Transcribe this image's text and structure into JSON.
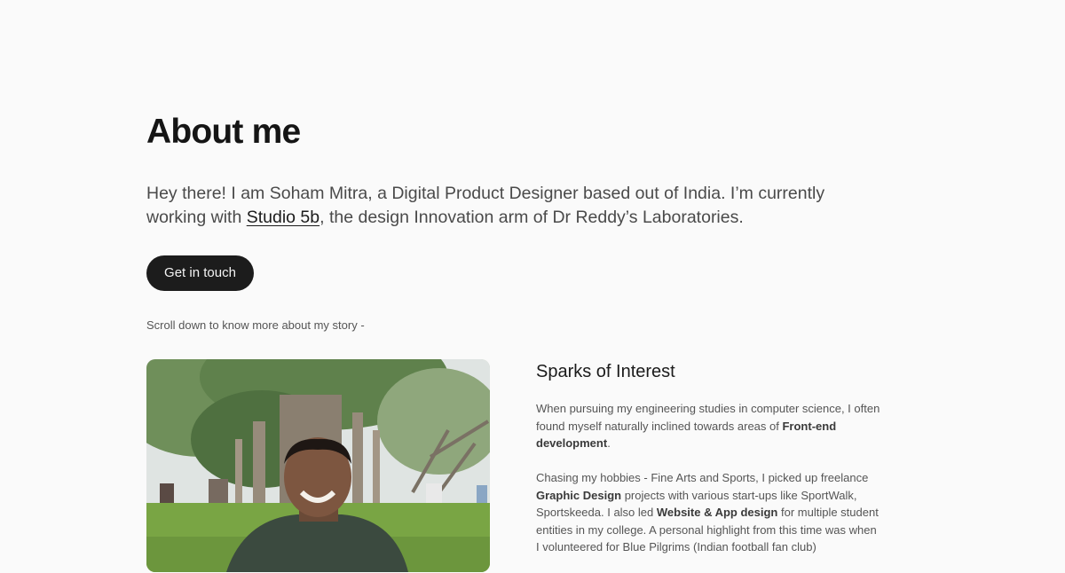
{
  "page": {
    "title": "About me"
  },
  "intro": {
    "before_link": "Hey there! I am Soham Mitra, a Digital Product Designer based out of India. I’m currently working with ",
    "link_text": "Studio 5b",
    "after_link": ", the design Innovation arm of Dr Reddy’s Laboratories."
  },
  "cta": {
    "label": "Get in touch"
  },
  "scroll_hint": "Scroll down to know more about my story -",
  "photo": {
    "icon": "portrait-photo"
  },
  "section": {
    "title": "Sparks of Interest",
    "p1": {
      "text1": "When pursuing my engineering studies in computer science, I often found myself naturally inclined towards areas of ",
      "bold1": "Front-end development",
      "text2": "."
    },
    "p2": {
      "text1": "Chasing my hobbies - Fine Arts and Sports, I picked up freelance ",
      "bold1": "Graphic Design",
      "text2": " projects with various start-ups like SportWalk, Sportskeeda. I also led ",
      "bold2": "Website & App design",
      "text3": " for multiple student entities in my college. A personal highlight from this time was when I volunteered for Blue Pilgrims (Indian football fan club)"
    }
  },
  "colors": {
    "background": "#fafafa",
    "text": "#1b1b1b",
    "muted": "#555555",
    "button": "#1c1c1c"
  }
}
